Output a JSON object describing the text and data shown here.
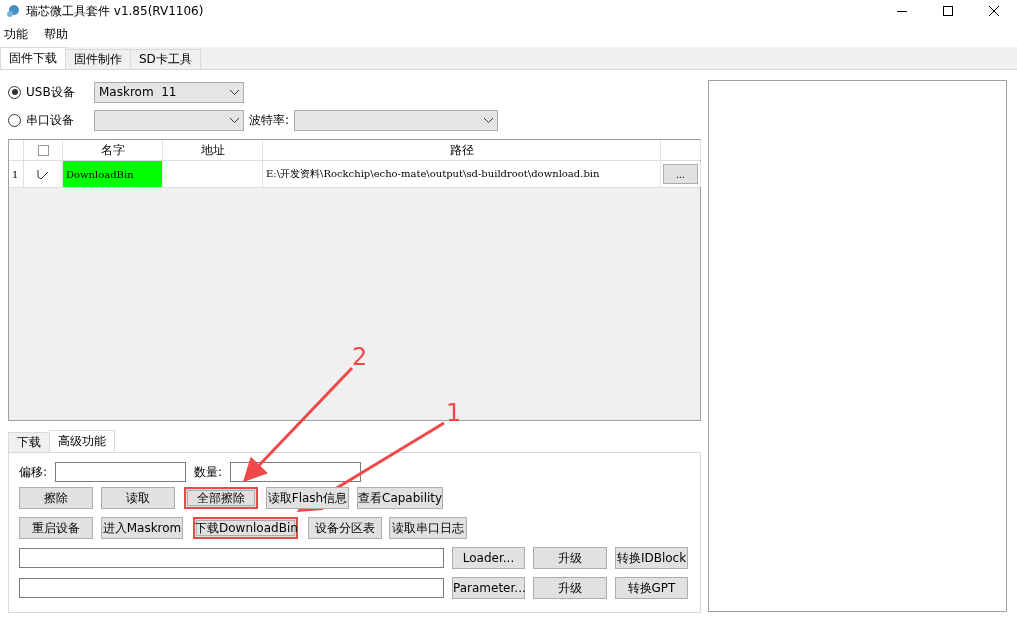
{
  "window": {
    "title": "瑞芯微工具套件 v1.85(RV1106)"
  },
  "menu": [
    "功能",
    "帮助"
  ],
  "tabs": [
    {
      "label": "固件下载",
      "selected": true
    },
    {
      "label": "固件制作",
      "selected": false
    },
    {
      "label": "SD卡工具",
      "selected": false
    }
  ],
  "device_rows": [
    {
      "label": "USB设备",
      "selected": true,
      "value": "Maskrom  11"
    },
    {
      "label": "串口设备",
      "selected": false,
      "value": "",
      "baud_label": "波特率:"
    }
  ],
  "table": {
    "all_checked": false,
    "columns": [
      "名字",
      "地址",
      "路径"
    ],
    "rows": [
      {
        "index": "1",
        "checked": true,
        "name": "DownloadBin",
        "address": "",
        "path": "E:\\开发资料\\Rockchip\\echo-mate\\output\\sd-buildroot\\download.bin",
        "browse": "..."
      }
    ]
  },
  "bottom_tabs": [
    {
      "label": "下载",
      "selected": false
    },
    {
      "label": "高级功能",
      "selected": true
    }
  ],
  "advanced": {
    "offset_label": "偏移:",
    "count_label": "数量:",
    "button_rows": [
      [
        {
          "label": "擦除",
          "highlighted": false
        },
        {
          "label": "读取",
          "highlighted": false
        },
        {
          "label": "全部擦除",
          "highlighted": true
        },
        {
          "label": "读取Flash信息",
          "highlighted": false
        },
        {
          "label": "查看Capability",
          "highlighted": false
        }
      ],
      [
        {
          "label": "重启设备",
          "highlighted": false
        },
        {
          "label": "进入Maskrom",
          "highlighted": false
        },
        {
          "label": "下载DownloadBin",
          "highlighted": true
        },
        {
          "label": "设备分区表",
          "highlighted": false
        },
        {
          "label": "读取串口日志",
          "highlighted": false
        }
      ]
    ],
    "file_rows": [
      {
        "pick": "Loader...",
        "upgrade": "升级",
        "convert": "转换IDBlock"
      },
      {
        "pick": "Parameter...",
        "upgrade": "升级",
        "convert": "转换GPT"
      }
    ]
  },
  "annotations": [
    {
      "label": "2"
    },
    {
      "label": "1"
    }
  ]
}
